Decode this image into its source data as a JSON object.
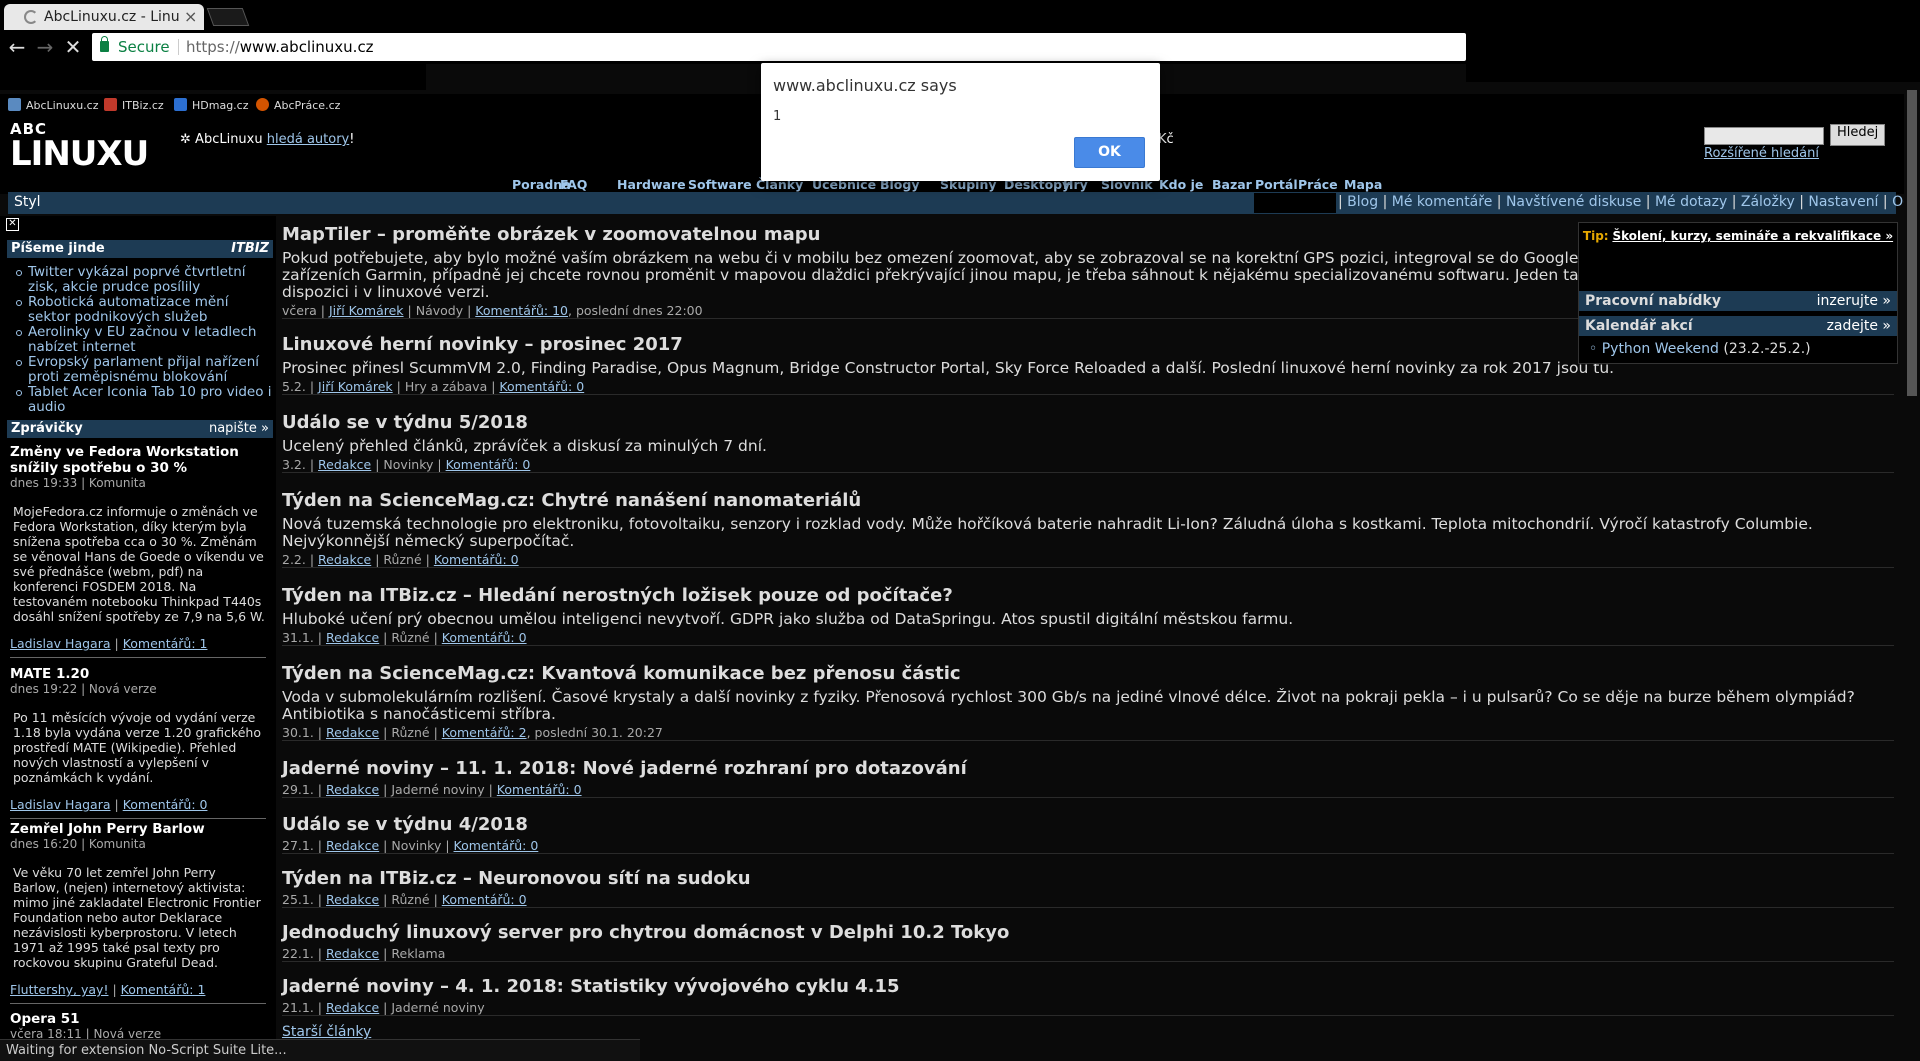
{
  "browser": {
    "tab_title": "AbcLinuxu.cz - Linu",
    "secure_label": "Secure",
    "url_proto": "https://",
    "url_host": "www.abclinuxu.cz",
    "bookmarks": [
      "AbcLinuxu.cz",
      "ITBiz.cz",
      "HDmag.cz",
      "AbcPráce.cz"
    ],
    "status": "Waiting for extension No-Script Suite Lite..."
  },
  "dialog": {
    "title": "www.abclinuxu.cz says",
    "message": "1",
    "ok": "OK"
  },
  "header": {
    "logo_top": "ABC",
    "logo_main": "LINUXU",
    "authors_prefix": "AbcLinuxu",
    "authors_link": "hledá autory",
    "authors_suffix": "!",
    "currency": "Kč",
    "search_button": "Hledej",
    "advanced_search": "Rozšířené hledání"
  },
  "menu": [
    "Poradna",
    "FAQ",
    "Hardware",
    "Software",
    "Články",
    "Učebnice",
    "Blogy",
    "Skupiny",
    "Desktopy",
    "Hry",
    "Slovník",
    "Kdo je",
    "Bazar",
    "Portál",
    "Práce",
    "Mapa"
  ],
  "stylbar": {
    "label": "Styl",
    "links": [
      "Blog",
      "Mé komentáře",
      "Navštívené diskuse",
      "Mé dotazy",
      "Záložky",
      "Nastavení",
      "Odhlásit"
    ]
  },
  "sidebar": {
    "jinde_title": "Píšeme jinde",
    "jinde_badge": "ITBIZ",
    "jinde_items": [
      "Twitter vykázal poprvé čtvrtletní zisk, akcie prudce posílily",
      "Robotická automatizace mění sektor podnikových služeb",
      "Aerolinky v EU začnou v letadlech nabízet internet",
      "Evropský parlament přijal nařízení proti zeměpisnému blokování",
      "Tablet Acer Iconia Tab 10 pro video i audio"
    ],
    "zpravicky_title": "Zprávičky",
    "zpravicky_action": "napište »",
    "news": [
      {
        "title": "Změny ve Fedora Workstation snížily spotřebu o 30 %",
        "meta": "dnes 19:33 | Komunita",
        "body": "MojeFedora.cz informuje o změnách ve Fedora Workstation, díky kterým byla snížena spotřeba cca o 30 %. Změnám se věnoval Hans de Goede o víkendu ve své přednášce (webm, pdf) na konferenci FOSDEM 2018. Na testovaném notebooku Thinkpad T440s dosáhl snížení spotřeby ze 7,9 na 5,6 W.",
        "author": "Ladislav Hagara",
        "comments": "Komentářů: 1"
      },
      {
        "title": "MATE 1.20",
        "meta": "dnes 19:22 | Nová verze",
        "body": "Po 11 měsících vývoje od vydání verze 1.18 byla vydána verze 1.20 grafického prostředí MATE (Wikipedie). Přehled nových vlastností a vylepšení v poznámkách k vydání.",
        "author": "Ladislav Hagara",
        "comments": "Komentářů: 0"
      },
      {
        "title": "Zemřel John Perry Barlow",
        "meta": "dnes 16:20 | Komunita",
        "body": "Ve věku 70 let zemřel John Perry Barlow, (nejen) internetový aktivista: mimo jiné zakladatel Electronic Frontier Foundation nebo autor Deklarace nezávislosti kyberprostoru. V letech 1971 až 1995 také psal texty pro rockovou skupinu Grateful Dead.",
        "author": "Fluttershy, yay!",
        "comments": "Komentářů: 1"
      },
      {
        "title": "Opera 51",
        "meta": "včera 18:11 | Nová verze",
        "body": "",
        "author": "",
        "comments": ""
      }
    ]
  },
  "articles": [
    {
      "title": "MapTiler – proměňte obrázek v zoomovatelnou mapu",
      "perex": "Pokud potřebujete, aby bylo možné vaším obrázkem na webu či v mobilu bez omezení zoomovat, aby se zobrazoval se na korektní GPS pozici, integroval se do Google Earth nebo se dal použít v GPS zařízeních Garmin, případně jej chcete rovnou proměnit v mapovou dlaždici překrývající jinou mapu, je třeba sáhnout k nějakému specializovanému softwaru. Jeden takový představuje MapTiler, který je k dispozici i v linuxové verzi.",
      "date": "včera",
      "author": "Jiří Komárek",
      "section": "Návody",
      "comments": "Komentářů: 10",
      "extra": ", poslední dnes 22:00"
    },
    {
      "title": "Linuxové herní novinky – prosinec 2017",
      "perex": "Prosinec přinesl ScummVM 2.0, Finding Paradise, Opus Magnum, Bridge Constructor Portal, Sky Force Reloaded a další. Poslední linuxové herní novinky za rok 2017 jsou tu.",
      "date": "5.2.",
      "author": "Jiří Komárek",
      "section": "Hry a zábava",
      "comments": "Komentářů: 0",
      "extra": ""
    },
    {
      "title": "Událo se v týdnu 5/2018",
      "perex": "Ucelený přehled článků, zprávíček a diskusí za minulých 7 dní.",
      "date": "3.2.",
      "author": "Redakce",
      "section": "Novinky",
      "comments": "Komentářů: 0",
      "extra": ""
    },
    {
      "title": "Týden na ScienceMag.cz: Chytré nanášení nanomateriálů",
      "perex": "Nová tuzemská technologie pro elektroniku, fotovoltaiku, senzory i rozklad vody. Může hořčíková baterie nahradit Li-Ion? Záludná úloha s kostkami. Teplota mitochondrií. Výročí katastrofy Columbie. Nejvýkonnější německý superpočítač.",
      "date": "2.2.",
      "author": "Redakce",
      "section": "Různé",
      "comments": "Komentářů: 0",
      "extra": ""
    },
    {
      "title": "Týden na ITBiz.cz – Hledání nerostných ložisek pouze od počítače?",
      "perex": "Hluboké učení prý obecnou umělou inteligenci nevytvoří. GDPR jako služba od DataSpringu. Atos spustil digitální městskou farmu.",
      "date": "31.1.",
      "author": "Redakce",
      "section": "Různé",
      "comments": "Komentářů: 0",
      "extra": ""
    },
    {
      "title": "Týden na ScienceMag.cz: Kvantová komunikace bez přenosu částic",
      "perex": "Voda v submolekulárním rozlišení. Časové krystaly a další novinky z fyziky. Přenosová rychlost 300 Gb/s na jediné vlnové délce. Život na pokraji pekla – i u pulsarů? Co se děje na burze během olympiád? Antibiotika s nanočásticemi stříbra.",
      "date": "30.1.",
      "author": "Redakce",
      "section": "Různé",
      "comments": "Komentářů: 2",
      "extra": ", poslední 30.1. 20:27"
    },
    {
      "title": "Jaderné noviny – 11. 1. 2018: Nové jaderné rozhraní pro dotazování",
      "perex": "",
      "date": "29.1.",
      "author": "Redakce",
      "section": "Jaderné noviny",
      "comments": "Komentářů: 0",
      "extra": ""
    },
    {
      "title": "Událo se v týdnu 4/2018",
      "perex": "",
      "date": "27.1.",
      "author": "Redakce",
      "section": "Novinky",
      "comments": "Komentářů: 0",
      "extra": ""
    },
    {
      "title": "Týden na ITBiz.cz – Neuronovou sítí na sudoku",
      "perex": "",
      "date": "25.1.",
      "author": "Redakce",
      "section": "Různé",
      "comments": "Komentářů: 0",
      "extra": ""
    },
    {
      "title": "Jednoduchý linuxový server pro chytrou domácnost v Delphi 10.2 Tokyo",
      "perex": "",
      "date": "22.1.",
      "author": "Redakce",
      "section": "Reklama",
      "comments": "",
      "extra": ""
    },
    {
      "title": "Jaderné noviny – 4. 1. 2018: Statistiky vývojového cyklu 4.15",
      "perex": "",
      "date": "21.1.",
      "author": "Redakce",
      "section": "Jaderné noviny",
      "comments": "",
      "extra": ""
    }
  ],
  "older_articles": "Starší články",
  "rightpanel": {
    "tip_label": "Tip:",
    "tip_link": "Školení, kurzy, semináře a rekvalifikace »",
    "jobs_title": "Pracovní nabídky",
    "jobs_action": "inzerujte »",
    "calendar_title": "Kalendář akcí",
    "calendar_action": "zadejte »",
    "event_name": "Python Weekend",
    "event_dates": "(23.2.-25.2.)"
  },
  "colors": {
    "accent_blue": "#1d3b54",
    "link": "#9fc6ea",
    "dialog_button": "#4a8be8",
    "secure_green": "#0b8043"
  }
}
